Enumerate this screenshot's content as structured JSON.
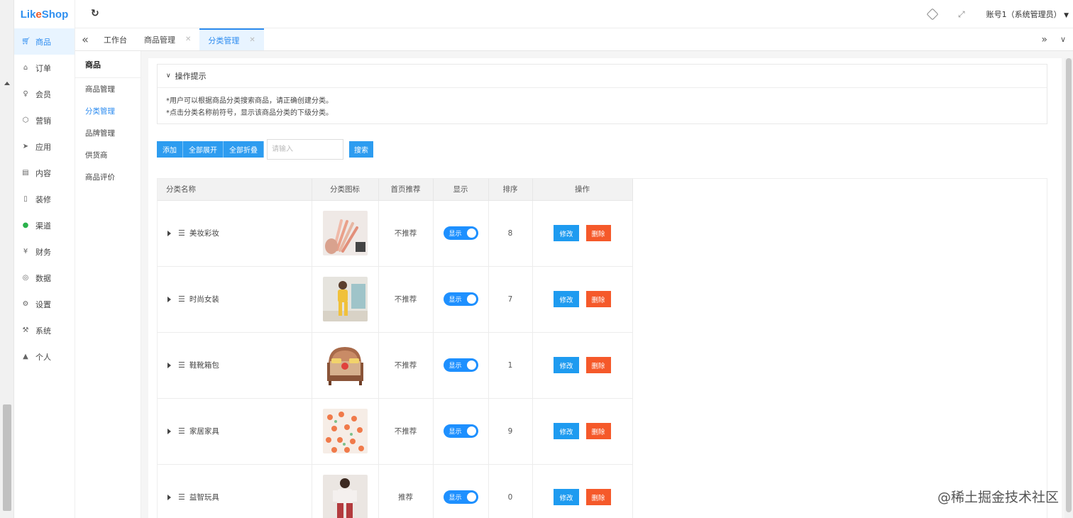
{
  "brand": {
    "name_part1": "Lik",
    "name_o": "e",
    "name_part2": "Shop"
  },
  "header": {
    "account": "账号1（系统管理员）"
  },
  "sidebar": {
    "items": [
      {
        "label": "商品",
        "icon": "cart-icon",
        "active": true
      },
      {
        "label": "订单",
        "icon": "bell-icon"
      },
      {
        "label": "会员",
        "icon": "user-icon"
      },
      {
        "label": "营销",
        "icon": "cube-icon"
      },
      {
        "label": "应用",
        "icon": "send-icon"
      },
      {
        "label": "内容",
        "icon": "book-icon"
      },
      {
        "label": "装修",
        "icon": "phone-icon"
      },
      {
        "label": "渠道",
        "icon": "wechat-icon"
      },
      {
        "label": "财务",
        "icon": "yen-icon"
      },
      {
        "label": "数据",
        "icon": "globe-icon"
      },
      {
        "label": "设置",
        "icon": "gear-icon"
      },
      {
        "label": "系统",
        "icon": "tools-icon"
      },
      {
        "label": "个人",
        "icon": "person-icon"
      }
    ]
  },
  "tabs": [
    {
      "label": "工作台",
      "closable": false
    },
    {
      "label": "商品管理",
      "closable": true
    },
    {
      "label": "分类管理",
      "closable": true,
      "active": true
    }
  ],
  "submenu": {
    "title": "商品",
    "items": [
      "商品管理",
      "分类管理",
      "品牌管理",
      "供货商",
      "商品评价"
    ],
    "active_index": 1
  },
  "tips": {
    "title": "操作提示",
    "line1": "*用户可以根据商品分类搜索商品，请正确创建分类。",
    "line2": "*点击分类名称前符号，显示该商品分类的下级分类。"
  },
  "toolbar": {
    "add": "添加",
    "expand_all": "全部展开",
    "collapse_all": "全部折叠",
    "search_placeholder": "请输入",
    "search": "搜索"
  },
  "table": {
    "headers": {
      "name": "分类名称",
      "icon": "分类图标",
      "recommend": "首页推荐",
      "show": "显示",
      "sort": "排序",
      "ops": "操作"
    },
    "rows": [
      {
        "name": "美妆彩妆",
        "recommend": "不推荐",
        "show": "显示",
        "sort": "8"
      },
      {
        "name": "时尚女装",
        "recommend": "不推荐",
        "show": "显示",
        "sort": "7"
      },
      {
        "name": "鞋靴箱包",
        "recommend": "不推荐",
        "show": "显示",
        "sort": "1"
      },
      {
        "name": "家居家具",
        "recommend": "不推荐",
        "show": "显示",
        "sort": "9"
      },
      {
        "name": "益智玩具",
        "recommend": "推荐",
        "show": "显示",
        "sort": "0"
      }
    ],
    "edit_label": "修改",
    "delete_label": "删除"
  },
  "watermark": "@稀土掘金技术社区",
  "colors": {
    "primary": "#2d8cf0",
    "danger": "#f5592a",
    "brand_orange": "#f05a28"
  }
}
